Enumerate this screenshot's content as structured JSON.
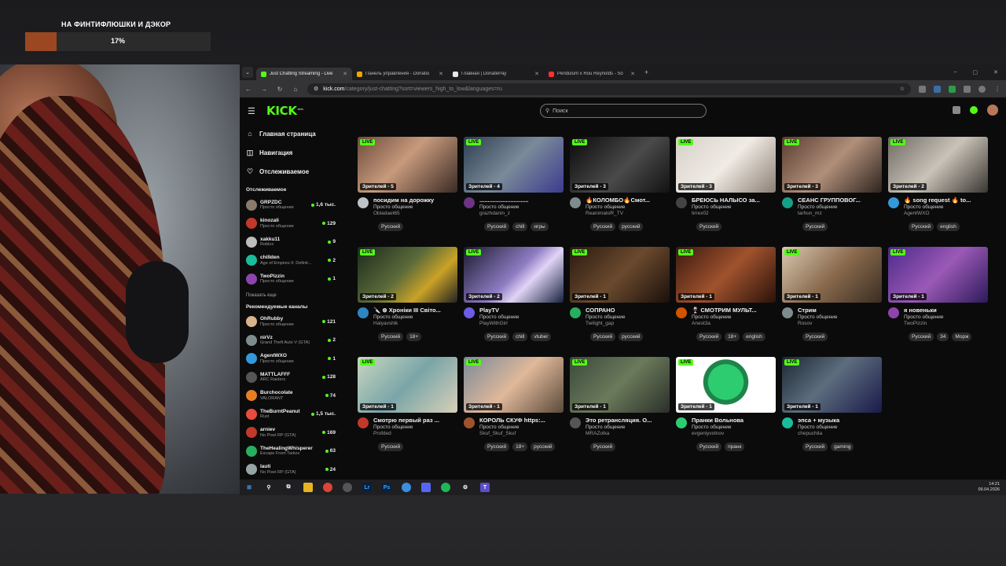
{
  "goal": {
    "title": "НА ФИНТИФЛЮШКИ И ДЭКОР",
    "percent_text": "17%",
    "progress": 0.17
  },
  "browser": {
    "tabs": [
      {
        "label": "Just Chatting Streaming - Live",
        "color": "#53fc18"
      },
      {
        "label": "Панель управления - Donatio",
        "color": "#f0a500"
      },
      {
        "label": "Главная | DonatePay",
        "color": "#e8e8e8"
      },
      {
        "label": "Pendulum x Rou Reynolds - So",
        "color": "#ff3030"
      }
    ],
    "url_host": "kick.com",
    "url_rest": "/category/just-chatting?sort=viewers_high_to_low&languages=ru"
  },
  "kick": {
    "logo": "KICK",
    "logo_sup": "BETA",
    "search_placeholder": "Поиск",
    "nav": [
      {
        "label": "Главная страница",
        "icon": "home-icon",
        "glyph": "⌂"
      },
      {
        "label": "Навигация",
        "icon": "compass-icon",
        "glyph": "◫"
      },
      {
        "label": "Отслеживаемое",
        "icon": "heart-icon",
        "glyph": "♡"
      }
    ],
    "following_title": "Отслеживаемое",
    "following": [
      {
        "name": "GRPZDC",
        "game": "Просто общение",
        "viewers": "1,6 тыс.",
        "color": "#8a7a6a"
      },
      {
        "name": "kinozali",
        "game": "Просто общение",
        "viewers": "129",
        "color": "#c0392b"
      },
      {
        "name": "xakku11",
        "game": "Roblox",
        "viewers": "9",
        "color": "#bdbdbd"
      },
      {
        "name": "chilIden",
        "game": "Age of Empires II: Definit...",
        "viewers": "2",
        "color": "#1abc9c"
      },
      {
        "name": "TwoPizzin",
        "game": "Просто общение",
        "viewers": "1",
        "color": "#8e44ad"
      }
    ],
    "show_more": "Показать еще",
    "recommended_title": "Рекомендуемые каналы",
    "recommended": [
      {
        "name": "OhRubby",
        "game": "Просто общение",
        "viewers": "121",
        "color": "#d9b38c"
      },
      {
        "name": "nirVz",
        "game": "Grand Theft Auto V (GTA)",
        "viewers": "2",
        "color": "#7f8c8d"
      },
      {
        "name": "AgentWXO",
        "game": "Просто общение",
        "viewers": "1",
        "color": "#3498db"
      },
      {
        "name": "MATTLAFFF",
        "game": "ARC Raiders",
        "viewers": "128",
        "color": "#555555"
      },
      {
        "name": "Burchocolate",
        "game": "VALORANT",
        "viewers": "74",
        "color": "#e67e22"
      },
      {
        "name": "TheBurntPeanut",
        "game": "Rust",
        "viewers": "1,5 тыс.",
        "color": "#e74c3c"
      },
      {
        "name": "arniev",
        "game": "No Pixel RP (GTA)",
        "viewers": "169",
        "color": "#c0392b"
      },
      {
        "name": "TheHealingWhisperer",
        "game": "Escape From Tarkov",
        "viewers": "63",
        "color": "#27ae60"
      },
      {
        "name": "lauti",
        "game": "No Pixel RP (GTA)",
        "viewers": "24",
        "color": "#95a5a6"
      }
    ],
    "live_label": "LIVE",
    "streams": [
      {
        "viewers": "Зрителей - 5",
        "title": "посидим на дорожку",
        "category": "Просто общение",
        "user": "Obladaet65",
        "tags": [
          "Русский"
        ],
        "avatar": "#bdc3c7",
        "thumb": "linear-gradient(135deg,#6d4c3d,#c79a7c 45%,#3a2a24)"
      },
      {
        "viewers": "Зрителей - 4",
        "title": "..............................",
        "category": "Просто общение",
        "user": "grazhdanin_z",
        "tags": [
          "Русский",
          "chill",
          "игры"
        ],
        "avatar": "#6c3483",
        "thumb": "linear-gradient(135deg,#2c3e50,#7b8a99 50%,#3b3b8f)"
      },
      {
        "viewers": "Зрителей - 3",
        "title": "🔥КОЛОМБО🔥Смот...",
        "category": "Просто общение",
        "user": "ReanimatoR_TV",
        "tags": [
          "Русский",
          "русский"
        ],
        "avatar": "#7f8c8d",
        "thumb": "linear-gradient(135deg,#0a0a0a,#4a4a4a 55%,#121212)"
      },
      {
        "viewers": "Зрителей - 3",
        "title": "БРЕЮСЬ НАЛЫСО за...",
        "category": "Просто общение",
        "user": "tirrex02",
        "tags": [
          "Русский"
        ],
        "avatar": "#444444",
        "thumb": "linear-gradient(135deg,#d6d0c8,#f0ebe5 50%,#8c7f74)"
      },
      {
        "viewers": "Зрителей - 3",
        "title": "СЕАНС ГРУППОВОГ...",
        "category": "Просто общение",
        "user": "tarhun_mz",
        "tags": [
          "Русский"
        ],
        "avatar": "#16a085",
        "thumb": "linear-gradient(135deg,#5a3d31,#b08f7a 50%,#2f241e)"
      },
      {
        "viewers": "Зрителей - 2",
        "title": "🔥 song request 🔥 to...",
        "category": "Просто общение",
        "user": "AgentWXO",
        "tags": [
          "Русский",
          "english"
        ],
        "avatar": "#3498db",
        "thumb": "linear-gradient(135deg,#6e6a63,#c9c3b8 50%,#3a3631)"
      },
      {
        "viewers": "Зрителей - 2",
        "title": "🔪 ⊗ Хроніки ІІІ Світо...",
        "category": "Просто общение",
        "user": "Halyavshik",
        "tags": [
          "Русский",
          "18+"
        ],
        "avatar": "#2e86c1",
        "thumb": "linear-gradient(135deg,#1c2a1c,#5b6b3a 45%,#c9a227 70%,#222)"
      },
      {
        "viewers": "Зрителей - 2",
        "title": "PlayTV",
        "category": "Просто общение",
        "user": "PlayWithGirl",
        "tags": [
          "Русский",
          "chill",
          "vtuber"
        ],
        "avatar": "#6c5ce7",
        "thumb": "linear-gradient(135deg,#1a1a2e,#8e7cc3 50%,#e0d4f5 65%,#16213e)"
      },
      {
        "viewers": "Зрителей - 1",
        "title": "СОПРАНО",
        "category": "Просто общение",
        "user": "Twilight_gap",
        "tags": [
          "Русский",
          "русский"
        ],
        "avatar": "#27ae60",
        "thumb": "linear-gradient(135deg,#2a1a10,#6b4a2e 50%,#1a100a)"
      },
      {
        "viewers": "Зрителей - 1",
        "title": "🍷 СМОТРИМ МУЛЬТ...",
        "category": "Просто общение",
        "user": "Anest3a",
        "tags": [
          "Русский",
          "18+",
          "english"
        ],
        "avatar": "#d35400",
        "thumb": "linear-gradient(135deg,#3a1a10,#a0522d 50%,#2a120a)"
      },
      {
        "viewers": "Зрителей - 1",
        "title": "Стрим",
        "category": "Просто общение",
        "user": "Rosov",
        "tags": [
          "Русский"
        ],
        "avatar": "#7f8c8d",
        "thumb": "linear-gradient(135deg,#d8c9b0,#8a6b4e 50%,#3b2d22)"
      },
      {
        "viewers": "Зрителей - 1",
        "title": "я новеньки",
        "category": "Просто общение",
        "user": "TwoPizzin",
        "tags": [
          "Русский",
          "34",
          "Морж"
        ],
        "avatar": "#8e44ad",
        "thumb": "linear-gradient(135deg,#4b2a8a,#9b59b6 50%,#2c1a5a)"
      },
      {
        "viewers": "Зрителей - 1",
        "title": "Смотрю первый раз ...",
        "category": "Просто общение",
        "user": "Profded",
        "tags": [
          "Русский"
        ],
        "avatar": "#c0392b",
        "thumb": "linear-gradient(135deg,#c8d6c0,#7aa5a8 50%,#d8d0b8)"
      },
      {
        "viewers": "Зрителей - 1",
        "title": "КОРОЛЬ СКУФ https:...",
        "category": "Просто общение",
        "user": "Skuf_Skuf_Skuf",
        "tags": [
          "Русский",
          "18+",
          "русский"
        ],
        "avatar": "#a0522d",
        "thumb": "linear-gradient(135deg,#7a8a9a,#e0b89a 50%,#5a4a3a)"
      },
      {
        "viewers": "Зрителей - 1",
        "title": "Это ретрансляция. О...",
        "category": "Просто общение",
        "user": "MRAZolka",
        "tags": [
          "Русский"
        ],
        "avatar": "#555555",
        "thumb": "linear-gradient(135deg,#3b4a3b,#6b7a5a 50%,#2a2f2a)"
      },
      {
        "viewers": "Зрителей - 1",
        "title": "Пранки Вольнова",
        "category": "Просто общение",
        "user": "evgeniyvolnov",
        "tags": [
          "Русский",
          "пранк"
        ],
        "avatar": "#2ecc71",
        "thumb": "radial-gradient(circle at 50% 45%,#2ecc71 0 30%,#1e8449 31% 38%,#ffffff 39%)"
      },
      {
        "viewers": "Зрителей - 1",
        "title": "эпса + музыка",
        "category": "Просто общение",
        "user": "chepuchila",
        "tags": [
          "Русский",
          "gaming"
        ],
        "avatar": "#1abc9c",
        "thumb": "linear-gradient(135deg,#1c2833,#5d6d7e 45%,#1a1a4a)"
      }
    ]
  },
  "taskbar": {
    "time": "14:21",
    "date": "09.04.2026"
  }
}
